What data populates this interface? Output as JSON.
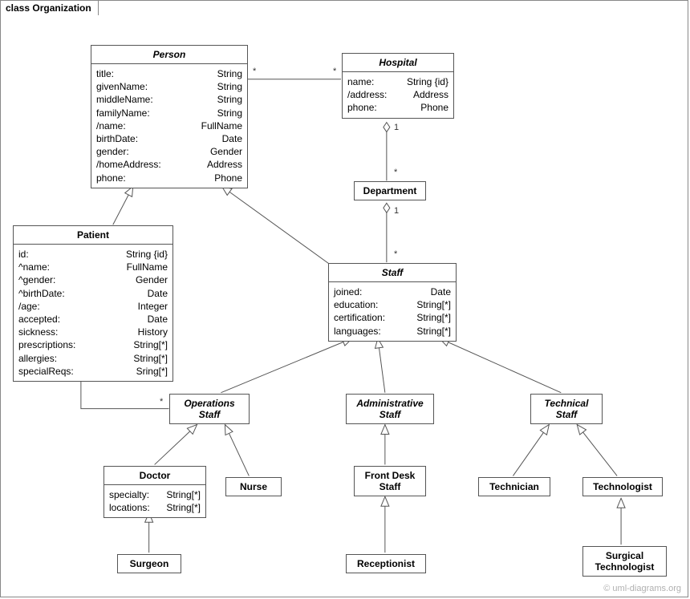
{
  "frame": {
    "label": "class Organization"
  },
  "credit": "© uml-diagrams.org",
  "mult": {
    "person_hosp_left": "*",
    "person_hosp_right": "*",
    "hosp_dept_top": "1",
    "hosp_dept_bottom": "*",
    "dept_staff_top": "1",
    "dept_staff_bottom": "*",
    "patient_ops_left": "*",
    "patient_ops_right": "*"
  },
  "classes": {
    "person": {
      "title": "Person",
      "attrs": [
        {
          "n": "title:",
          "t": "String"
        },
        {
          "n": "givenName:",
          "t": "String"
        },
        {
          "n": "middleName:",
          "t": "String"
        },
        {
          "n": "familyName:",
          "t": "String"
        },
        {
          "n": "/name:",
          "t": "FullName"
        },
        {
          "n": "birthDate:",
          "t": "Date"
        },
        {
          "n": "gender:",
          "t": "Gender"
        },
        {
          "n": "/homeAddress:",
          "t": "Address"
        },
        {
          "n": "phone:",
          "t": "Phone"
        }
      ]
    },
    "hospital": {
      "title": "Hospital",
      "attrs": [
        {
          "n": "name:",
          "t": "String {id}"
        },
        {
          "n": "/address:",
          "t": "Address"
        },
        {
          "n": "phone:",
          "t": "Phone"
        }
      ]
    },
    "department": {
      "title": "Department"
    },
    "patient": {
      "title": "Patient",
      "attrs": [
        {
          "n": "id:",
          "t": "String {id}"
        },
        {
          "n": "^name:",
          "t": "FullName"
        },
        {
          "n": "^gender:",
          "t": "Gender"
        },
        {
          "n": "^birthDate:",
          "t": "Date"
        },
        {
          "n": "/age:",
          "t": "Integer"
        },
        {
          "n": "accepted:",
          "t": "Date"
        },
        {
          "n": "sickness:",
          "t": "History"
        },
        {
          "n": "prescriptions:",
          "t": "String[*]"
        },
        {
          "n": "allergies:",
          "t": "String[*]"
        },
        {
          "n": "specialReqs:",
          "t": "Sring[*]"
        }
      ]
    },
    "staff": {
      "title": "Staff",
      "attrs": [
        {
          "n": "joined:",
          "t": "Date"
        },
        {
          "n": "education:",
          "t": "String[*]"
        },
        {
          "n": "certification:",
          "t": "String[*]"
        },
        {
          "n": "languages:",
          "t": "String[*]"
        }
      ]
    },
    "opsStaff": {
      "title": "Operations\nStaff"
    },
    "adminStaff": {
      "title": "Administrative\nStaff"
    },
    "techStaff": {
      "title": "Technical\nStaff"
    },
    "doctor": {
      "title": "Doctor",
      "attrs": [
        {
          "n": "specialty:",
          "t": "String[*]"
        },
        {
          "n": "locations:",
          "t": "String[*]"
        }
      ]
    },
    "nurse": {
      "title": "Nurse"
    },
    "frontDesk": {
      "title": "Front Desk\nStaff"
    },
    "technician": {
      "title": "Technician"
    },
    "technologist": {
      "title": "Technologist"
    },
    "surgeon": {
      "title": "Surgeon"
    },
    "receptionist": {
      "title": "Receptionist"
    },
    "surgTech": {
      "title": "Surgical\nTechnologist"
    }
  }
}
